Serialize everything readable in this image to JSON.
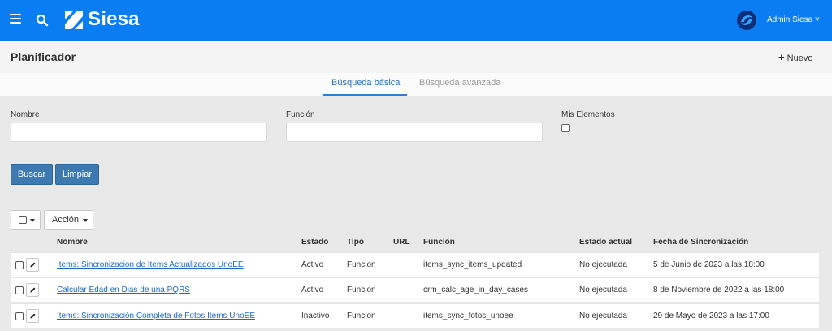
{
  "header": {
    "brand": "Siesa",
    "user_menu": "Admin Siesa ˅",
    "colors": {
      "topbar": "#0a7df2",
      "primary_button": "#3d7ab2",
      "link": "#1a6ad0"
    }
  },
  "page": {
    "title": "Planificador",
    "new_label": "Nuevo"
  },
  "tabs": {
    "basic": "Búsqueda básica",
    "advanced": "Búsqueda avanzada",
    "active": "basic"
  },
  "filters": {
    "name_label": "Nombre",
    "name_value": "",
    "function_label": "Función",
    "function_value": "",
    "mine_label": "Mis Elementos"
  },
  "actions": {
    "search": "Buscar",
    "clear": "Limpiar",
    "action_menu": "Acción"
  },
  "table": {
    "columns": {
      "name": "Nombre",
      "status": "Estado",
      "type": "Tipo",
      "url": "URL",
      "function": "Función",
      "current_status": "Estado actual",
      "sync_date": "Fecha de Sincronización"
    },
    "rows": [
      {
        "name": "Items: Sincronizacion de Items Actualizados UnoEE",
        "status": "Activo",
        "type": "Funcion",
        "url": "",
        "function": "items_sync_items_updated",
        "current_status": "No ejecutada",
        "sync_date": "5 de Junio de 2023 a las 18:00"
      },
      {
        "name": "Calcular Edad en Dias de una PQRS",
        "status": "Activo",
        "type": "Funcion",
        "url": "",
        "function": "crm_calc_age_in_day_cases",
        "current_status": "No ejecutada",
        "sync_date": "8 de Noviembre de 2022 a las 18:00"
      },
      {
        "name": "Items: Sincronización Completa de Fotos Items UnoEE",
        "status": "Inactivo",
        "type": "Funcion",
        "url": "",
        "function": "items_sync_fotos_unoee",
        "current_status": "No ejecutada",
        "sync_date": "29 de Mayo de 2023 a las 17:00"
      }
    ]
  },
  "icons": [
    "menu-icon",
    "search-icon",
    "siesa-logo-icon",
    "avatar-icon",
    "plus-icon",
    "checkbox-icon",
    "pencil-icon",
    "caret-down-icon"
  ]
}
